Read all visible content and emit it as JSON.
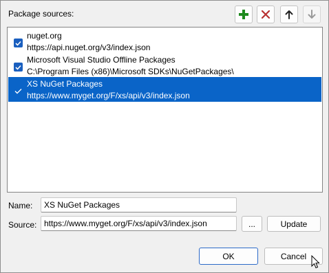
{
  "header": {
    "label": "Package sources:"
  },
  "toolbar": {
    "add_icon": "plus-icon",
    "remove_icon": "x-icon",
    "up_icon": "arrow-up-icon",
    "down_icon": "arrow-down-icon",
    "colors": {
      "add": "#1e8a1e",
      "remove": "#b83030"
    }
  },
  "sources": [
    {
      "name": "nuget.org",
      "url": "https://api.nuget.org/v3/index.json",
      "checked": true,
      "selected": false
    },
    {
      "name": "Microsoft Visual Studio Offline Packages",
      "url": "C:\\Program Files (x86)\\Microsoft SDKs\\NuGetPackages\\",
      "checked": true,
      "selected": false
    },
    {
      "name": "XS NuGet Packages",
      "url": "https://www.myget.org/F/xs/api/v3/index.json",
      "checked": true,
      "selected": true
    }
  ],
  "form": {
    "name_label": "Name:",
    "name_value": "XS NuGet Packages",
    "source_label": "Source:",
    "source_value": "https://www.myget.org/F/xs/api/v3/index.json",
    "browse_label": "...",
    "update_label": "Update"
  },
  "buttons": {
    "ok": "OK",
    "cancel": "Cancel"
  },
  "colors": {
    "selection": "#0a64c8",
    "checkbox": "#1a5fbf"
  }
}
